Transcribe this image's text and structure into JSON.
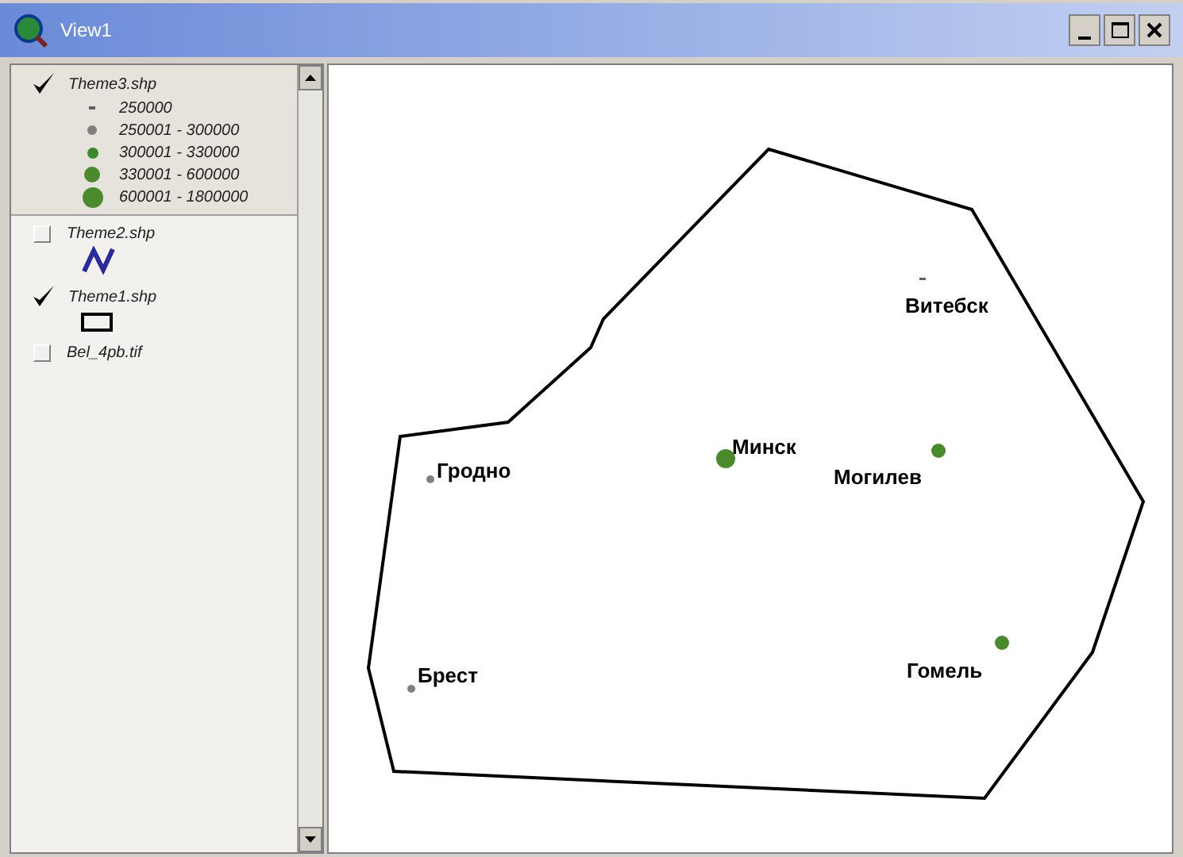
{
  "window": {
    "title": "View1"
  },
  "legend": {
    "themes": [
      {
        "label": "Theme3.shp",
        "checked": true,
        "selected": true,
        "kind": "classes",
        "classes": [
          {
            "label": "250000",
            "kind": "c1"
          },
          {
            "label": "250001 - 300000",
            "kind": "c2"
          },
          {
            "label": "300001 - 330000",
            "kind": "c3"
          },
          {
            "label": "330001 - 600000",
            "kind": "c4"
          },
          {
            "label": "600001 - 1800000",
            "kind": "c5"
          }
        ]
      },
      {
        "label": "Theme2.shp",
        "checked": false,
        "selected": false,
        "kind": "line"
      },
      {
        "label": "Theme1.shp",
        "checked": true,
        "selected": false,
        "kind": "polygon"
      },
      {
        "label": "Bel_4pb.tif",
        "checked": false,
        "selected": false,
        "kind": "raster"
      }
    ]
  },
  "map": {
    "cities": [
      {
        "label": "Витебск",
        "kind": "c1"
      },
      {
        "label": "Минск",
        "kind": "c5"
      },
      {
        "label": "Могилев",
        "kind": "c4"
      },
      {
        "label": "Гродно",
        "kind": "c2"
      },
      {
        "label": "Брест",
        "kind": "c2"
      },
      {
        "label": "Гомель",
        "kind": "c4"
      }
    ]
  }
}
